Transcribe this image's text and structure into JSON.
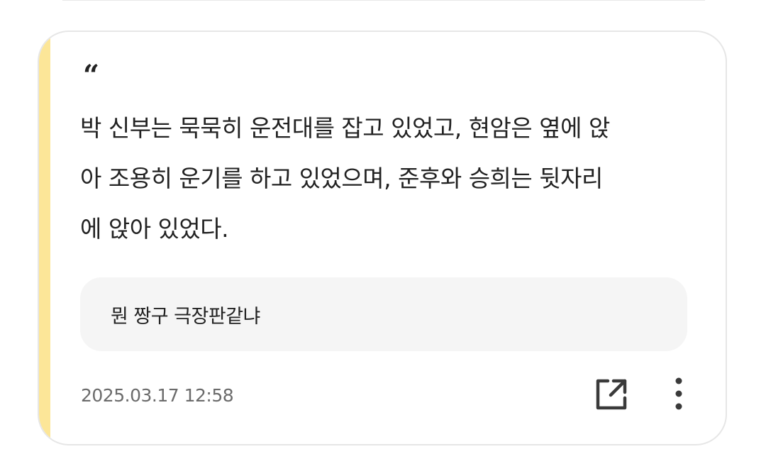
{
  "quote_card": {
    "accent_color": "#FCE698",
    "quote_mark": "“",
    "quote_lines": [
      "박 신부는 묵묵히 운전대를 잡고 있었고, 현암은 옆에 앉",
      "아 조용히 운기를 하고 있었으며, 준후와 승희는 뒷자리",
      "에 앉아 있었다."
    ],
    "comment": "뭔 짱구 극장판같냐",
    "timestamp": "2025.03.17 12:58",
    "share_icon": "share-external-icon",
    "more_icon": "more-vertical-icon"
  }
}
